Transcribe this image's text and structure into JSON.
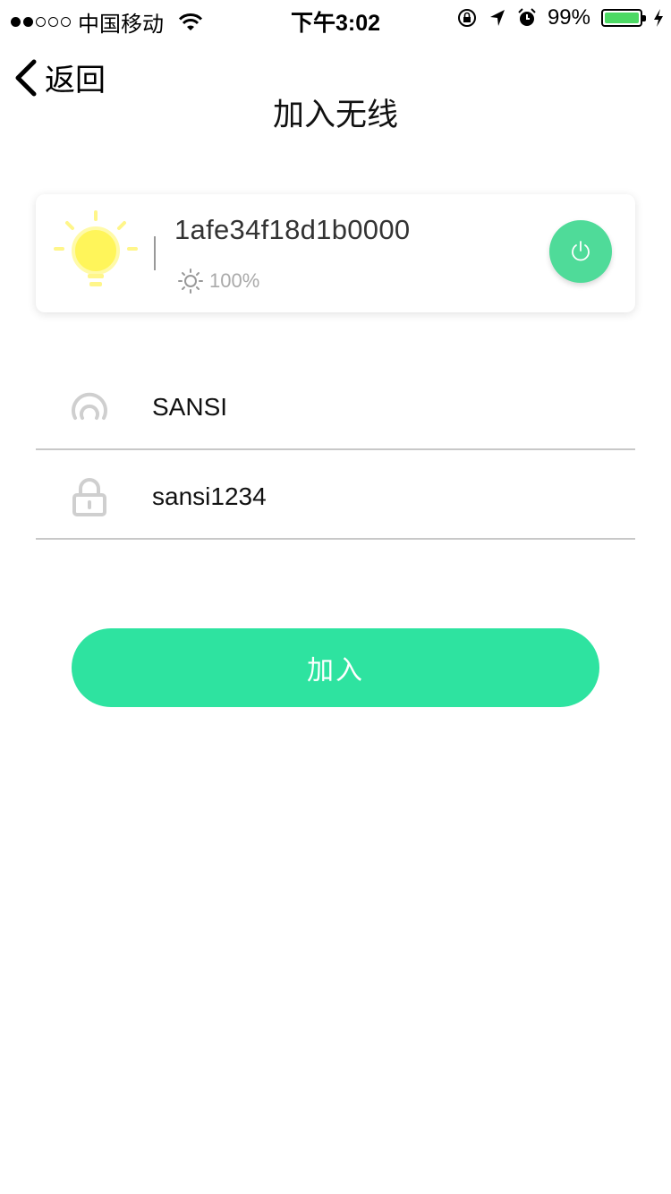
{
  "status_bar": {
    "carrier": "中国移动",
    "time": "下午3:02",
    "battery_text": "99%",
    "battery_level": 0.99
  },
  "nav": {
    "back_label": "返回",
    "title": "加入无线"
  },
  "device": {
    "name": "1afe34f18d1b0000",
    "brightness": "100%",
    "power_color": "#4fdb99"
  },
  "form": {
    "ssid_value": "SANSI",
    "password_value": "sansi1234"
  },
  "join_button": {
    "label": "加入",
    "color": "#2ee3a0"
  }
}
